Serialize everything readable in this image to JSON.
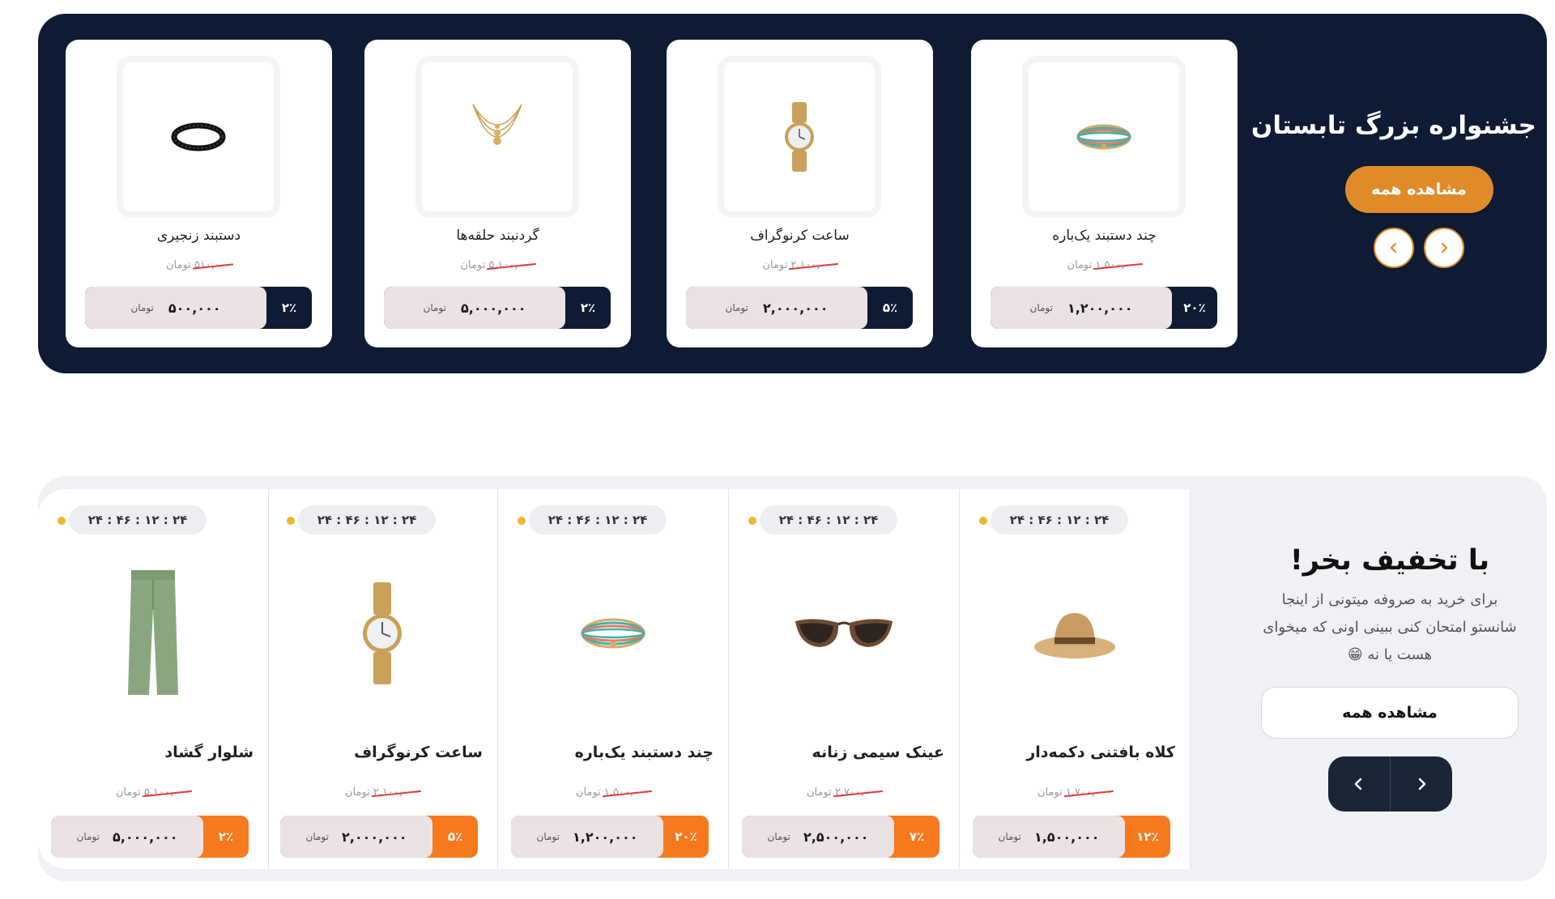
{
  "festival": {
    "title": "جشنواره بزرگ تابستان",
    "view_all": "مشاهده همه",
    "products": [
      {
        "name": "چند دستبند یک‌باره",
        "old_price": "۱,۵۰۰,۰۰۰",
        "currency": "تومان",
        "price": "۱,۲۰۰,۰۰۰",
        "discount": "۲۰٪",
        "icon": "bead-bracelet-icon"
      },
      {
        "name": "ساعت کرنوگراف",
        "old_price": "۲,۱۰۰,۰۰۰",
        "currency": "تومان",
        "price": "۲,۰۰۰,۰۰۰",
        "discount": "۵٪",
        "icon": "gold-watch-icon"
      },
      {
        "name": "گردنبند حلقه‌ها",
        "old_price": "۵,۱۰۰,۰۰۰",
        "currency": "تومان",
        "price": "۵,۰۰۰,۰۰۰",
        "discount": "۲٪",
        "icon": "necklace-icon"
      },
      {
        "name": "دستبند زنجیری",
        "old_price": "۵۱۰,۰۰۰",
        "currency": "تومان",
        "price": "۵۰۰,۰۰۰",
        "discount": "۲٪",
        "icon": "black-bracelet-icon"
      }
    ],
    "colors": {
      "background": "#0f1b34",
      "accent": "#e08b2a"
    }
  },
  "discount_section": {
    "title": "با تخفیف بخر!",
    "description": "برای خرید به صروفه میتونی از اینجا شانستو امتحان کنی ببینی اونی که میخوای هست یا نه 😁",
    "view_all": "مشاهده همه",
    "products": [
      {
        "name": "کلاه بافتنی دکمه‌دار",
        "timer": "۲۴ : ۴۶ : ۱۲ : ۲۴",
        "old_price": "۱,۷۰۰,۰۰۰",
        "currency": "تومان",
        "price": "۱,۵۰۰,۰۰۰",
        "discount": "۱۲٪",
        "icon": "straw-hat-icon"
      },
      {
        "name": "عینک سیمی زنانه",
        "timer": "۲۴ : ۴۶ : ۱۲ : ۲۴",
        "old_price": "۲,۷۰۰,۰۰۰",
        "currency": "تومان",
        "price": "۲,۵۰۰,۰۰۰",
        "discount": "۷٪",
        "icon": "sunglasses-icon"
      },
      {
        "name": "چند دستبند یک‌باره",
        "timer": "۲۴ : ۴۶ : ۱۲ : ۲۴",
        "old_price": "۱,۵۰۰,۰۰۰",
        "currency": "تومان",
        "price": "۱,۲۰۰,۰۰۰",
        "discount": "۲۰٪",
        "icon": "bead-bracelet-icon"
      },
      {
        "name": "ساعت کرنوگراف",
        "timer": "۲۴ : ۴۶ : ۱۲ : ۲۴",
        "old_price": "۲,۱۰۰,۰۰۰",
        "currency": "تومان",
        "price": "۲,۰۰۰,۰۰۰",
        "discount": "۵٪",
        "icon": "gold-watch-icon"
      },
      {
        "name": "شلوار گشاد",
        "timer": "۲۴ : ۴۶ : ۱۲ : ۲۴",
        "old_price": "۵,۱۰۰,۰۰۰",
        "currency": "تومان",
        "price": "۵,۰۰۰,۰۰۰",
        "discount": "۲٪",
        "icon": "trousers-icon"
      }
    ],
    "colors": {
      "background": "#f0f1f4",
      "accent": "#f7791e",
      "nav": "#1a2638",
      "timer_dot": "#f2b52c"
    }
  }
}
